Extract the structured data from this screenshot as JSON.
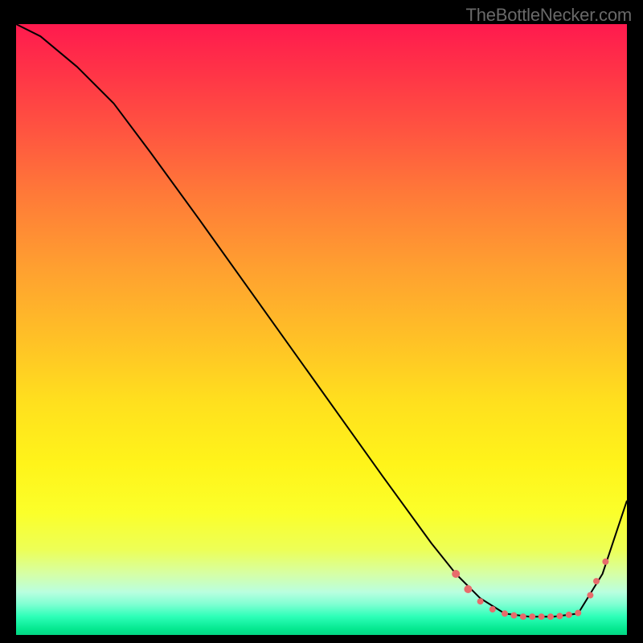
{
  "attribution": "TheBottleNecker.com",
  "colors": {
    "curve": "#000000",
    "marker_fill": "#e86b6b",
    "marker_stroke": "#c94f4f"
  },
  "chart_data": {
    "type": "line",
    "title": "",
    "xlabel": "",
    "ylabel": "",
    "xlim": [
      0,
      100
    ],
    "ylim": [
      0,
      100
    ],
    "series": [
      {
        "name": "curve",
        "x": [
          0,
          4,
          10,
          16,
          22,
          30,
          40,
          50,
          60,
          68,
          72,
          76,
          80,
          84,
          88,
          92,
          96,
          100
        ],
        "y": [
          100,
          98,
          93,
          87,
          79,
          68,
          54,
          40,
          26,
          15,
          10,
          6,
          3.5,
          3,
          3,
          3.5,
          10,
          22
        ]
      }
    ],
    "markers": {
      "name": "highlighted-points",
      "points": [
        {
          "x": 72,
          "y": 10,
          "r": 5
        },
        {
          "x": 74,
          "y": 7.5,
          "r": 5
        },
        {
          "x": 76,
          "y": 5.5,
          "r": 4
        },
        {
          "x": 78,
          "y": 4.2,
          "r": 4
        },
        {
          "x": 80,
          "y": 3.5,
          "r": 4
        },
        {
          "x": 81.5,
          "y": 3.2,
          "r": 4
        },
        {
          "x": 83,
          "y": 3.0,
          "r": 4
        },
        {
          "x": 84.5,
          "y": 3.0,
          "r": 4
        },
        {
          "x": 86,
          "y": 3.0,
          "r": 4
        },
        {
          "x": 87.5,
          "y": 3.0,
          "r": 4
        },
        {
          "x": 89,
          "y": 3.1,
          "r": 4
        },
        {
          "x": 90.5,
          "y": 3.3,
          "r": 4
        },
        {
          "x": 92,
          "y": 3.6,
          "r": 4
        },
        {
          "x": 94,
          "y": 6.5,
          "r": 4
        },
        {
          "x": 95,
          "y": 8.8,
          "r": 4
        },
        {
          "x": 96.5,
          "y": 12.0,
          "r": 4
        }
      ]
    }
  }
}
